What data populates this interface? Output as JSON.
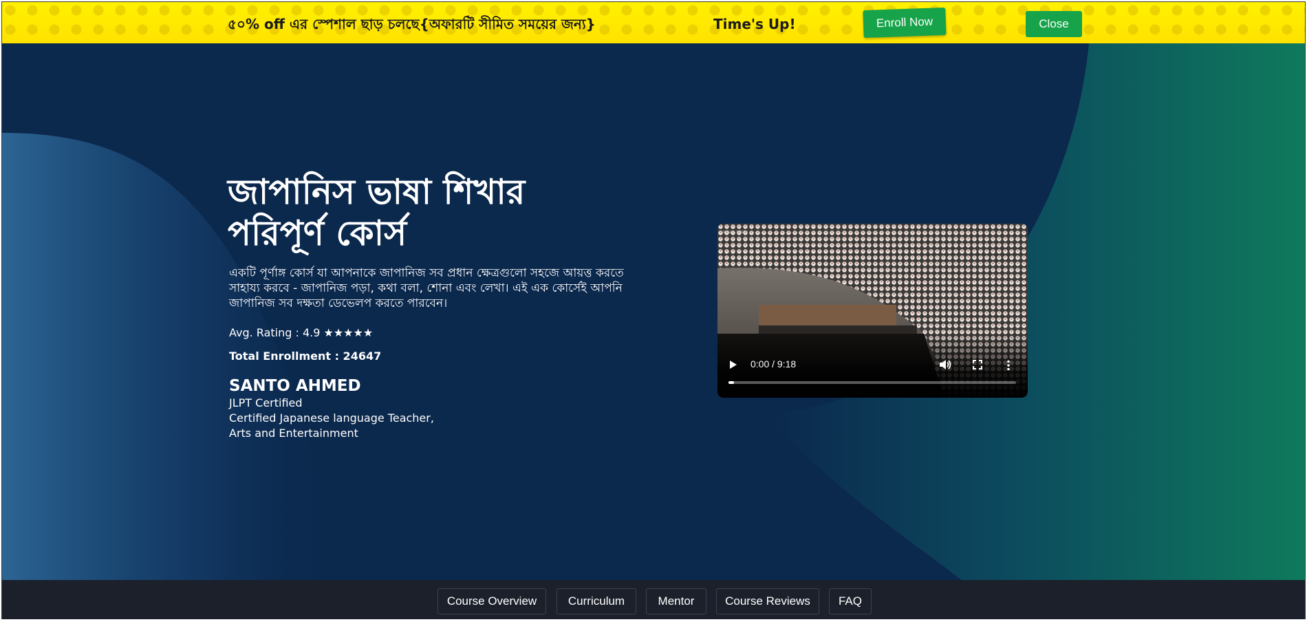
{
  "promo": {
    "text": "৫০% off এর স্পেশাল ছাড় চলছে{অফারটি সীমিত সময়ের জন্য}",
    "timer": "Time's Up!",
    "enroll_label": "Enroll Now",
    "close_label": "Close"
  },
  "hero": {
    "title": "জাপানিস ভাষা শিখার পরিপূর্ণ কোর্স",
    "description": "একটি পূর্ণাঙ্গ কোর্স যা আপনাকে জাপানিজ সব প্রধান ক্ষেত্রগুলো সহজে আয়ত্ত করতে সাহায্য করবে - জাপানিজ পড়া, কথা বলা, শোনা এবং লেখা। এই এক কোর্সেই আপনি জাপানিজ সব দক্ষতা ডেভেলপ করতে পারবেন।",
    "rating": "Avg. Rating : 4.9 ★★★★★",
    "enrollment": "Total Enrollment : 24647",
    "mentor": {
      "name": "SANTO AHMED",
      "lines": [
        "JLPT Certified",
        "Certified Japanese language Teacher,",
        "Arts and Entertainment"
      ]
    }
  },
  "video": {
    "time": "0:00 / 9:18",
    "progress": 0.02,
    "icons": [
      "play-icon",
      "volume-icon",
      "fullscreen-icon",
      "more-options-icon"
    ]
  },
  "nav": {
    "items": [
      "Course Overview",
      "Curriculum",
      "Mentor",
      "Course Reviews",
      "FAQ"
    ]
  },
  "colors": {
    "promo_bg": "#ffe81a",
    "accent_green": "#17a34a",
    "hero_navy": "#0b284d",
    "hero_teal": "#0e7a5c",
    "nav_bg": "#1b202b"
  }
}
